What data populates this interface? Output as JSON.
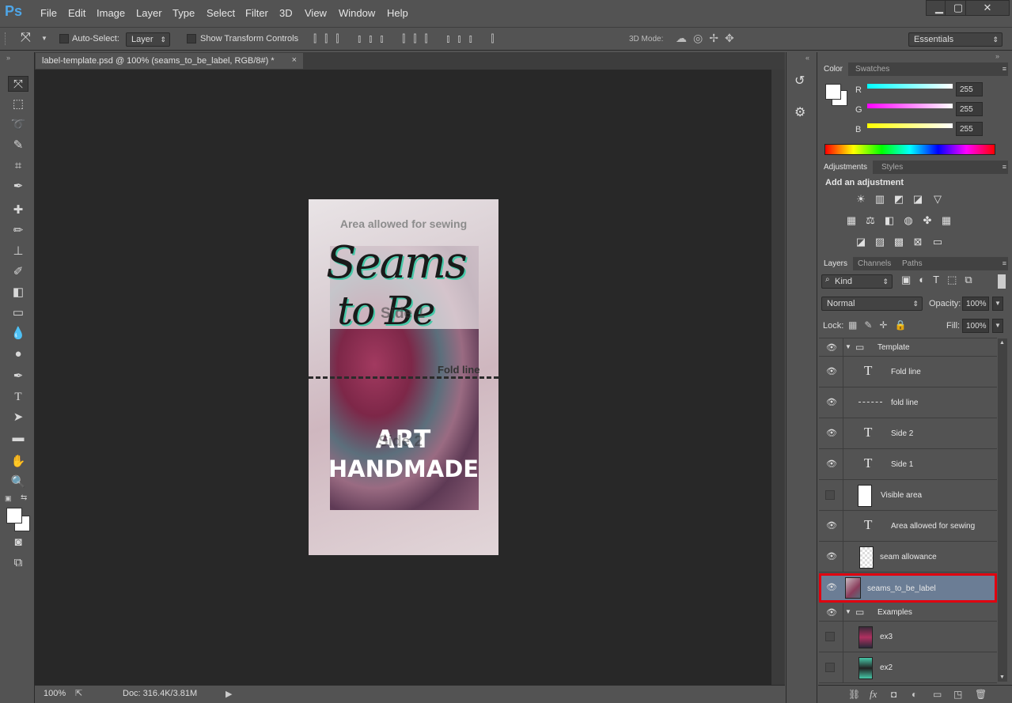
{
  "app": {
    "logo": "Ps"
  },
  "menu": [
    "File",
    "Edit",
    "Image",
    "Layer",
    "Type",
    "Select",
    "Filter",
    "3D",
    "View",
    "Window",
    "Help"
  ],
  "window_controls": {
    "minimize": "▁",
    "restore": "▢",
    "close": "✕"
  },
  "options": {
    "auto_select_label": "Auto-Select:",
    "auto_select_target": "Layer",
    "show_transform_label": "Show Transform Controls",
    "mode3d_label": "3D Mode:",
    "workspace": "Essentials"
  },
  "document": {
    "tab_title": "label-template.psd @ 100% (seams_to_be_label, RGB/8#) *",
    "tab_close": "×",
    "zoom": "100%",
    "doc_size": "Doc: 316.4K/3.81M"
  },
  "canvas": {
    "area_text": "Area allowed for sewing",
    "brand_line1": "Seams",
    "brand_line2": "to Be",
    "side1": "Side 1",
    "fold_text": "Fold line",
    "art_line1": "ART",
    "art_line2": "HANDMADE",
    "side2": "Side 2"
  },
  "color_panel": {
    "tabs": [
      "Color",
      "Swatches"
    ],
    "channels": [
      {
        "label": "R",
        "value": "255"
      },
      {
        "label": "G",
        "value": "255"
      },
      {
        "label": "B",
        "value": "255"
      }
    ]
  },
  "adjustments_panel": {
    "tabs": [
      "Adjustments",
      "Styles"
    ],
    "heading": "Add an adjustment"
  },
  "layers_panel": {
    "tabs": [
      "Layers",
      "Channels",
      "Paths"
    ],
    "filter": "Kind",
    "blend_mode": "Normal",
    "opacity_label": "Opacity:",
    "opacity": "100%",
    "lock_label": "Lock:",
    "fill_label": "Fill:",
    "fill": "100%",
    "layers": [
      {
        "name": "Template",
        "kind": "group",
        "visible": true
      },
      {
        "name": "Fold line",
        "kind": "text",
        "visible": true
      },
      {
        "name": "fold line",
        "kind": "line",
        "visible": true
      },
      {
        "name": "Side 2",
        "kind": "text",
        "visible": true
      },
      {
        "name": "Side 1",
        "kind": "text",
        "visible": true
      },
      {
        "name": "Visible area",
        "kind": "pixel",
        "visible": false
      },
      {
        "name": "Area allowed for sewing",
        "kind": "text",
        "visible": true
      },
      {
        "name": "seam allowance",
        "kind": "pixel",
        "visible": true
      },
      {
        "name": "seams_to_be_label",
        "kind": "smart",
        "visible": true,
        "selected": true
      },
      {
        "name": "Examples",
        "kind": "group",
        "visible": true
      },
      {
        "name": "ex3",
        "kind": "image",
        "visible": false
      },
      {
        "name": "ex2",
        "kind": "image",
        "visible": false
      }
    ],
    "fx_label": "fx"
  },
  "colors": {
    "selection_outline": "#e0000f",
    "selected_layer": "#6b7d95",
    "teal": "#46c8a8"
  }
}
